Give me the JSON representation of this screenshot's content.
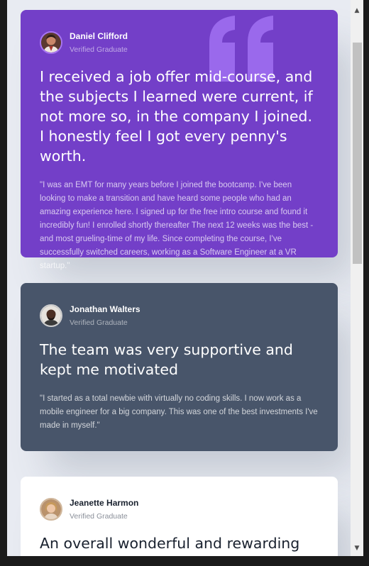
{
  "testimonials": [
    {
      "name": "Daniel Clifford",
      "status": "Verified Graduate",
      "headline": "I received a job offer mid-course, and the subjects I learned were current, if not more so, in the company I joined. I honestly feel I got every penny's worth.",
      "body": "\"I was an EMT for many years before I joined the bootcamp. I've been looking to make a transition and have heard some people who had an amazing experience here. I signed up for the free intro course and found it incredibly fun! I enrolled shortly thereafter The next 12 weeks was the best - and most grueling-time of my life. Since completing the course, I've successfully switched careers, working as a Software Engineer at a VR startup.\""
    },
    {
      "name": "Jonathan Walters",
      "status": "Verified Graduate",
      "headline": "The team was very supportive and kept me motivated",
      "body": "\"I started as a total newbie with virtually no coding skills. I now work as a mobile engineer for a big company. This was one of the best investments I've made in myself.\""
    },
    {
      "name": "Jeanette Harmon",
      "status": "Verified Graduate",
      "headline": "An overall wonderful and rewarding experience",
      "body": ""
    }
  ],
  "colors": {
    "purple": "#733fc8",
    "slate": "#48556a",
    "white": "#ffffff",
    "background": "#e8ebf2"
  },
  "scrollbar": {
    "up_icon": "▲",
    "down_icon": "▼"
  }
}
